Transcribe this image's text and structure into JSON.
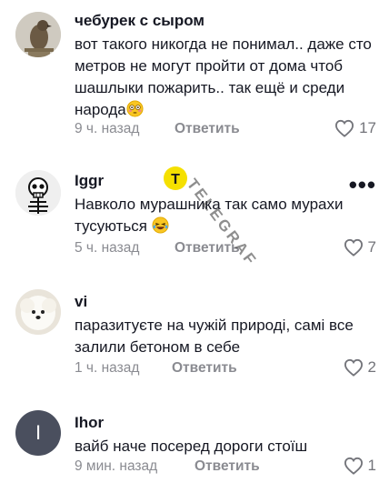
{
  "comments": [
    {
      "username": "чебурек с сыром",
      "text": "вот такого никогда не понимал.. даже сто метров не могут пройти от дома чтоб шашлыки пожарить.. так ещё и среди народа",
      "emoji": "flushed-face",
      "time": "9 ч. назад",
      "reply_label": "Ответить",
      "likes": "17",
      "avatar": "bird-avatar"
    },
    {
      "username": "Iggr",
      "text": "Навколо мурашника так само мурахи тусуються",
      "emoji": "laughing-face",
      "time": "5 ч. назад",
      "reply_label": "Ответить",
      "likes": "7",
      "avatar": "skeleton-avatar",
      "more": "•••"
    },
    {
      "username": "vi",
      "text": "паразитуєте на чужій природі, самі все залили бетоном в себе",
      "time": "1 ч. назад",
      "reply_label": "Ответить",
      "likes": "2",
      "avatar": "dog-avatar"
    },
    {
      "username": "Ihor",
      "text": "вайб наче посеред дороги стоїш",
      "time": "9 мин. назад",
      "reply_label": "Ответить",
      "likes": "1",
      "avatar": "letter-avatar",
      "avatar_letter": "I"
    }
  ],
  "watermark": "TELEGRAF",
  "colors": {
    "text": "#161823",
    "meta": "#8a8b91",
    "letter_avatar_bg": "#4a4f5e",
    "watermark_badge": "#f5e000"
  }
}
